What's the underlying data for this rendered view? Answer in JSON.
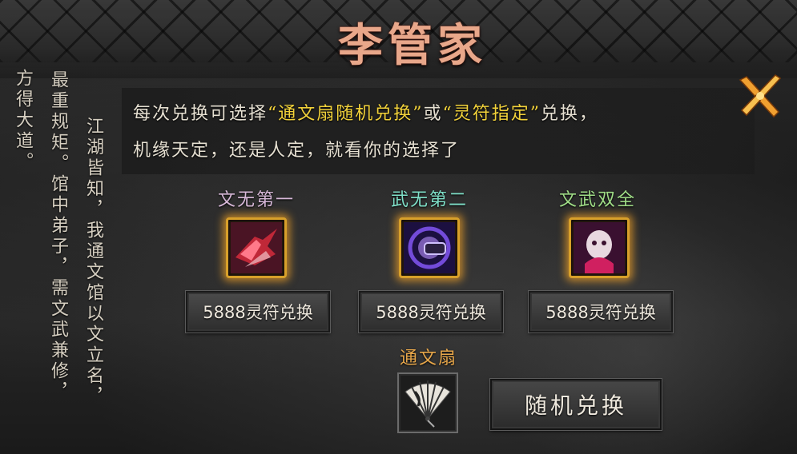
{
  "title": "李管家",
  "left_text": {
    "col1": "方得大道。",
    "col2": "最重规矩。馆中弟子，需文武兼修，",
    "col3": "江湖皆知，我通文馆以文立名，"
  },
  "description": {
    "line1_pre": "每次兑换可选择",
    "line1_opt1": "“通文扇随机兑换”",
    "line1_mid": "或",
    "line1_opt2": "“灵符指定”",
    "line1_post": "兑换，",
    "line2": "机缘天定，还是人定，就看你的选择了"
  },
  "items": [
    {
      "title": "文无第一",
      "title_color": "#d7b8d8",
      "button": "5888灵符兑换",
      "icon": "crimson-blade-skill-icon"
    },
    {
      "title": "武无第二",
      "title_color": "#7fe0c8",
      "button": "5888灵符兑换",
      "icon": "purple-fist-skill-icon"
    },
    {
      "title": "文武双全",
      "title_color": "#9fdc86",
      "button": "5888灵符兑换",
      "icon": "mask-skill-icon"
    }
  ],
  "fan": {
    "title": "通文扇",
    "icon": "folding-fan-icon",
    "button": "随机兑换"
  },
  "colors": {
    "highlight": "#f2d23a",
    "title": "#e8a78a",
    "slot_border": "#d8a02a"
  },
  "close_icon": "crossed-brush-close-icon"
}
